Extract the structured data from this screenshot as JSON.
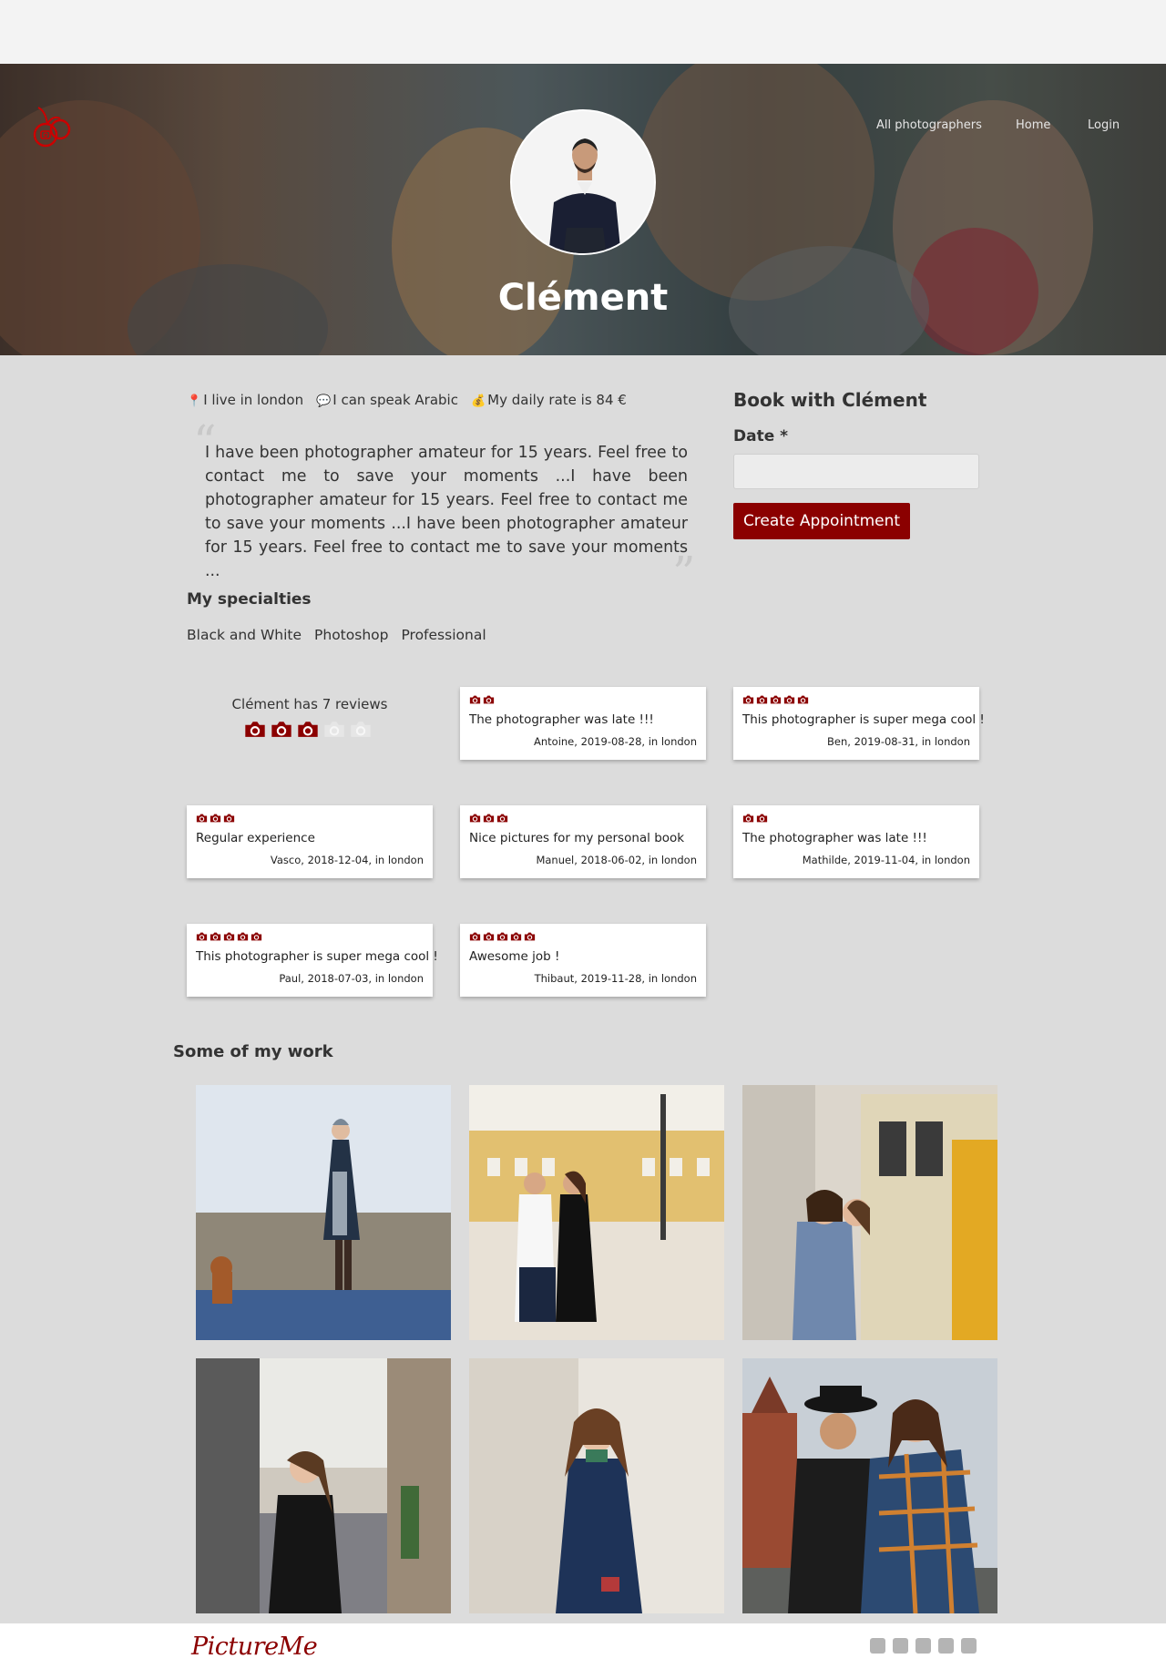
{
  "nav": {
    "links": [
      "All photographers",
      "Home",
      "Login"
    ]
  },
  "hero": {
    "name": "Clément"
  },
  "profile": {
    "location": "I live in london",
    "language": "I can speak Arabic",
    "rate": "My daily rate is 84 €",
    "bio": "I have been photographer amateur for 15 years. Feel free to contact me to save your moments ...I have been photographer amateur for 15 years. Feel free to contact me to save your moments ...I have been photographer amateur for 15 years. Feel free to contact me to save your moments ...",
    "specialties_title": "My specialties",
    "specialties": [
      "Black and White",
      "Photoshop",
      "Professional"
    ]
  },
  "booking": {
    "title": "Book with Clément",
    "date_label": "Date",
    "required_mark": "*",
    "button": "Create Appointment"
  },
  "reviews": {
    "summary": "Clément has 7 reviews",
    "average": 3,
    "max": 5,
    "items": [
      {
        "rating": 2,
        "text": "The photographer was late !!!",
        "meta": "Antoine, 2019-08-28, in london"
      },
      {
        "rating": 5,
        "text": "This photographer is super mega cool !",
        "meta": "Ben, 2019-08-31, in london"
      },
      {
        "rating": 3,
        "text": "Regular experience",
        "meta": "Vasco, 2018-12-04, in london"
      },
      {
        "rating": 3,
        "text": "Nice pictures for my personal book",
        "meta": "Manuel, 2018-06-02, in london"
      },
      {
        "rating": 2,
        "text": "The photographer was late !!!",
        "meta": "Mathilde, 2019-11-04, in london"
      },
      {
        "rating": 5,
        "text": "This photographer is super mega cool !",
        "meta": "Paul, 2018-07-03, in london"
      },
      {
        "rating": 5,
        "text": "Awesome job !",
        "meta": "Thibaut, 2019-11-28, in london"
      }
    ]
  },
  "work": {
    "title": "Some of my work"
  },
  "footer": {
    "brand": "PictureMe",
    "social_icons": [
      "github-icon",
      "instagram-icon",
      "facebook-icon",
      "twitter-icon",
      "linkedin-icon"
    ]
  },
  "colors": {
    "accent": "#8b0000",
    "background": "#dcdcdc"
  }
}
